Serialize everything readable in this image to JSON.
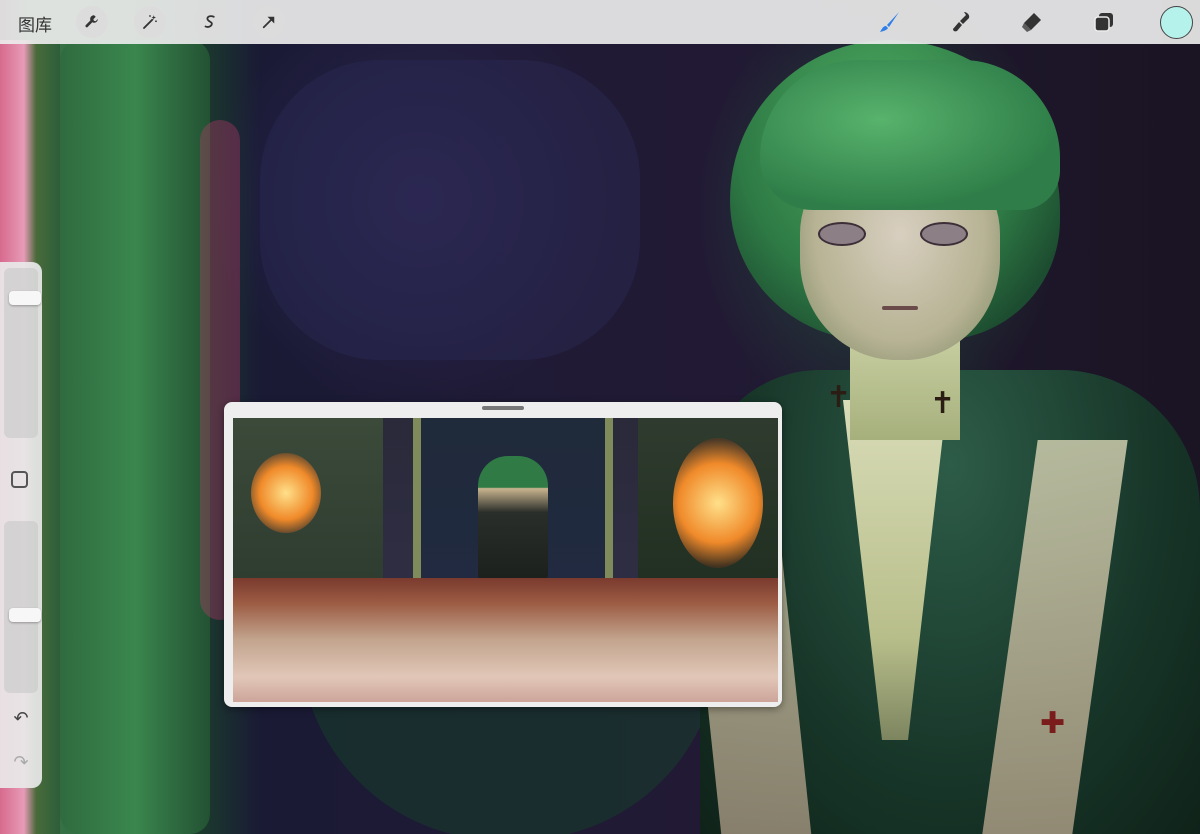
{
  "toolbar": {
    "gallery_label": "图库",
    "left_tools": [
      "wrench-icon",
      "magic-wand-icon",
      "selection-icon",
      "transform-arrow-icon"
    ],
    "right_tools": [
      "brush-icon",
      "smudge-icon",
      "eraser-icon",
      "layers-icon"
    ],
    "active_tool": "brush-icon",
    "active_tool_color": "#2f7fe8",
    "current_color": "#b6f2ec"
  },
  "sidebar": {
    "brush_size_level": 0.15,
    "opacity_level": 0.55,
    "undo_symbol": "↶",
    "redo_symbol": "↷"
  },
  "reference_window": {
    "visible": true
  }
}
